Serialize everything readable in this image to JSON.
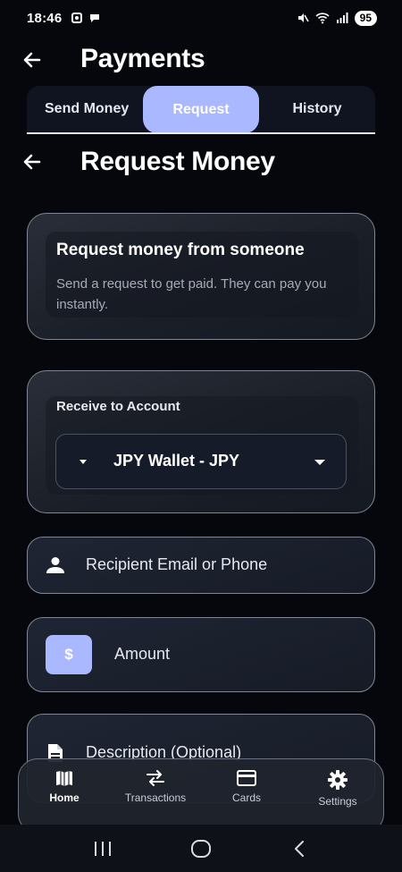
{
  "status_bar": {
    "time": "18:46",
    "battery": "95"
  },
  "header": {
    "title": "Payments"
  },
  "tabs": [
    {
      "label": "Send Money",
      "active": false
    },
    {
      "label": "Request",
      "active": true
    },
    {
      "label": "History",
      "active": false
    }
  ],
  "section": {
    "title": "Request Money"
  },
  "info_card": {
    "title": "Request money from someone",
    "description": "Send a request to get paid. They can pay you instantly."
  },
  "account": {
    "label": "Receive to Account",
    "selected": "JPY Wallet - JPY"
  },
  "fields": {
    "recipient_placeholder": "Recipient Email or Phone",
    "amount_placeholder": "Amount",
    "amount_symbol": "$",
    "description_placeholder": "Description (Optional)"
  },
  "bottom_nav": [
    {
      "label": "Home",
      "icon": "map-icon",
      "active": true
    },
    {
      "label": "Transactions",
      "icon": "swap-arrows-icon",
      "active": false
    },
    {
      "label": "Cards",
      "icon": "credit-card-icon",
      "active": false
    },
    {
      "label": "Settings",
      "icon": "gear-icon",
      "active": false
    }
  ],
  "colors": {
    "accent": "#a9b8ff",
    "background": "#05070c",
    "card_border": "#7f8594"
  }
}
